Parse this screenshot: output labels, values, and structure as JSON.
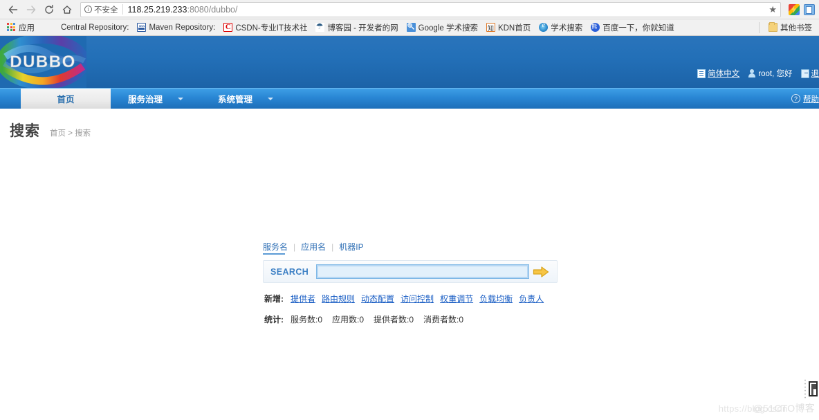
{
  "browser": {
    "back_icon": "back-arrow-icon",
    "forward_icon": "forward-arrow-icon",
    "reload_icon": "reload-icon",
    "home_icon": "home-icon",
    "security_label": "不安全",
    "url_host": "118.25.219.233",
    "url_rest": ":8080/dubbo/",
    "star_icon": "★",
    "bookmarks": [
      {
        "label": "应用",
        "icon": "apps-grid-icon"
      },
      {
        "label": "Central Repository:",
        "icon": ""
      },
      {
        "label": "Maven Repository:",
        "icon": "maven-icon"
      },
      {
        "label": "CSDN-专业IT技术社",
        "icon": "csdn-icon"
      },
      {
        "label": "博客园 - 开发者的网",
        "icon": "cnblogs-icon"
      },
      {
        "label": "Google 学术搜索",
        "icon": "google-scholar-icon"
      },
      {
        "label": "KDN首页",
        "icon": "kdn-icon"
      },
      {
        "label": "学术搜索",
        "icon": "ie-icon"
      },
      {
        "label": "百度一下，你就知道",
        "icon": "baidu-icon"
      }
    ],
    "other_bookmarks": "其他书签"
  },
  "app": {
    "logo_text": "DUBBO",
    "top_links": {
      "language": "简体中文",
      "user": "root, 您好",
      "logout": "退"
    },
    "nav": {
      "items": [
        {
          "label": "首页",
          "active": true,
          "has_caret": false
        },
        {
          "label": "服务治理",
          "active": false,
          "has_caret": true
        },
        {
          "label": "系统管理",
          "active": false,
          "has_caret": true
        }
      ],
      "help_label": "帮助"
    },
    "page_title": "搜索",
    "breadcrumb": "首页 > 搜索"
  },
  "search": {
    "tabs": [
      {
        "label": "服务名",
        "active": true
      },
      {
        "label": "应用名",
        "active": false
      },
      {
        "label": "机器IP",
        "active": false
      }
    ],
    "tab_separator": "|",
    "button_label": "SEARCH",
    "input_value": "",
    "input_placeholder": "",
    "go_icon": "right-arrow-icon"
  },
  "actions": {
    "label": "新增:",
    "links": [
      "提供者",
      "路由规则",
      "动态配置",
      "访问控制",
      "权重调节",
      "负载均衡",
      "负责人"
    ]
  },
  "stats": {
    "label": "统计:",
    "items": [
      "服务数:0",
      "应用数:0",
      "提供者数:0",
      "消费者数:0"
    ]
  },
  "watermark": {
    "text1": "https://blog.csdn",
    "text2": "@51CTO博客"
  },
  "colors": {
    "header_blue": "#1c63a8",
    "nav_blue": "#2986d4",
    "link_blue": "#1a5ec4",
    "accent_orange": "#f0b429"
  }
}
